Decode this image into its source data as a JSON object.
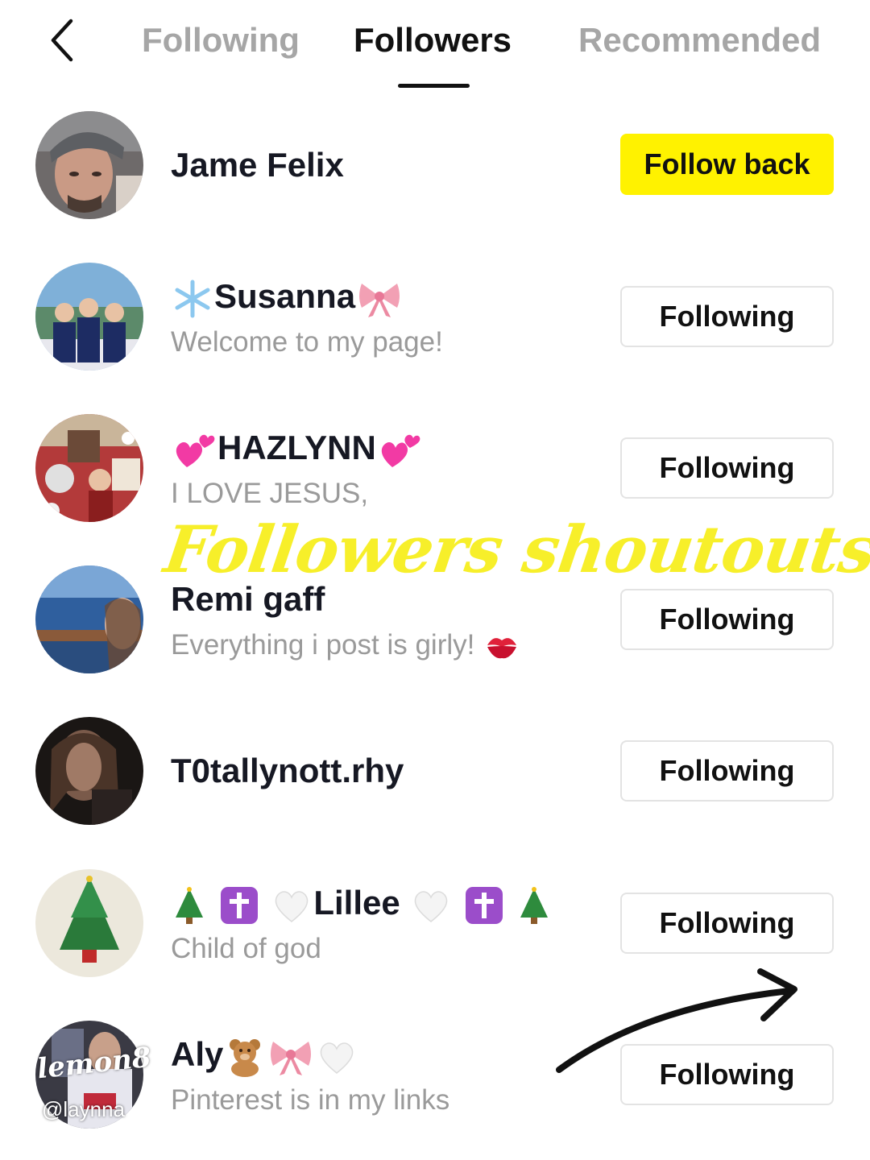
{
  "tabs": [
    {
      "label": "Following",
      "active": false
    },
    {
      "label": "Followers",
      "active": true
    },
    {
      "label": "Recommended",
      "active": false
    }
  ],
  "colors": {
    "follow_back_bg": "#fff200",
    "overlay_text": "#f7ef2a",
    "muted_text": "#9a9a9a"
  },
  "followers": [
    {
      "name": "Jame Felix",
      "bio": "",
      "button": "Follow back"
    },
    {
      "name": "Susanna",
      "name_prefix_icon": "snowflake-icon",
      "name_suffix_icon": "bow-icon",
      "bio": "Welcome to my page!",
      "button": "Following"
    },
    {
      "name": "HAZLYNN",
      "name_prefix_icon": "two-hearts-icon",
      "name_suffix_icon": "two-hearts-icon",
      "bio": "I LOVE JESUS,",
      "button": "Following"
    },
    {
      "name": "Remi gaff",
      "bio": "Everything i post is girly!",
      "bio_suffix_icon": "kiss-mark-icon",
      "button": "Following"
    },
    {
      "name": "T0tallynott.rhy",
      "bio": "",
      "button": "Following"
    },
    {
      "name": "Lillee",
      "name_prefix_icons": [
        "christmas-tree-icon",
        "cross-icon",
        "white-heart-icon"
      ],
      "name_suffix_icons": [
        "white-heart-icon",
        "cross-icon",
        "christmas-tree-icon"
      ],
      "bio": "Child of god",
      "button": "Following"
    },
    {
      "name": "Aly",
      "name_suffix_icons": [
        "teddy-bear-icon",
        "bow-icon",
        "white-heart-icon"
      ],
      "bio": "Pinterest is in my links",
      "button": "Following"
    }
  ],
  "overlay": {
    "shoutout_text": "Followers shoutouts",
    "watermark": "lemon8",
    "handle": "@laynna"
  }
}
